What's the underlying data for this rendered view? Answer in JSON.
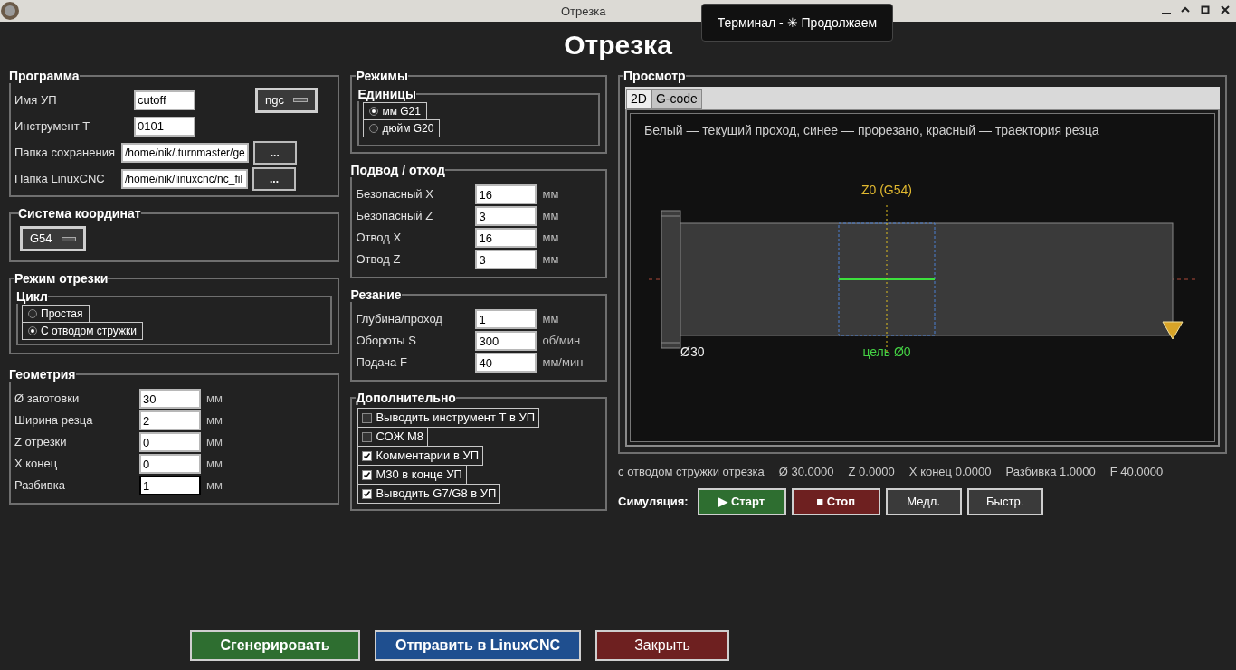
{
  "window": {
    "title": "Отрезка"
  },
  "tooltip": "Терминал - ✳ Продолжаем",
  "heading": "Отрезка",
  "program": {
    "title": "Программа",
    "format": "ngc",
    "fields": [
      {
        "label": "Имя УП",
        "value": "cutoff"
      },
      {
        "label": "Инструмент T",
        "value": "0101"
      },
      {
        "label": "Папка сохранения",
        "value": "/home/nik/.turnmaster/ge",
        "button": "..."
      },
      {
        "label": "Папка LinuxCNC",
        "value": "/home/nik/linuxcnc/nc_fil",
        "button": "..."
      }
    ]
  },
  "coordinate_system": {
    "title": "Система координат",
    "value": "G54"
  },
  "cut_mode": {
    "title": "Режим отрезки",
    "cycle": {
      "title": "Цикл",
      "options": [
        {
          "label": "Простая",
          "selected": false
        },
        {
          "label": "С отводом стружки",
          "selected": true
        }
      ]
    }
  },
  "geometry": {
    "title": "Геометрия",
    "fields": [
      {
        "label": "Ø заготовки",
        "value": "30",
        "unit": "мм",
        "focused": false
      },
      {
        "label": "Ширина резца",
        "value": "2",
        "unit": "мм",
        "focused": false
      },
      {
        "label": "Z отрезки",
        "value": "0",
        "unit": "мм",
        "focused": false
      },
      {
        "label": "X конец",
        "value": "0",
        "unit": "мм",
        "focused": false
      },
      {
        "label": "Разбивка",
        "value": "1",
        "unit": "мм",
        "focused": true
      }
    ]
  },
  "modes": {
    "title": "Режимы",
    "units": {
      "title": "Единицы",
      "options": [
        {
          "label": "мм G21",
          "selected": true
        },
        {
          "label": "дюйм G20",
          "selected": false
        }
      ]
    }
  },
  "approach": {
    "title": "Подвод / отход",
    "fields": [
      {
        "label": "Безопасный X",
        "value": "16",
        "unit": "мм",
        "focused": false
      },
      {
        "label": "Безопасный Z",
        "value": "3",
        "unit": "мм",
        "focused": false
      },
      {
        "label": "Отвод X",
        "value": "16",
        "unit": "мм",
        "focused": false
      },
      {
        "label": "Отвод Z",
        "value": "3",
        "unit": "мм",
        "focused": false
      }
    ]
  },
  "cutting": {
    "title": "Резание",
    "fields": [
      {
        "label": "Глубина/проход",
        "value": "1",
        "unit": "мм",
        "focused": false
      },
      {
        "label": "Обороты S",
        "value": "300",
        "unit": "об/мин",
        "focused": false
      },
      {
        "label": "Подача F",
        "value": "40",
        "unit": "мм/мин",
        "focused": false
      }
    ]
  },
  "extra": {
    "title": "Дополнительно",
    "options": [
      {
        "label": "Выводить инструмент T в УП",
        "checked": false
      },
      {
        "label": "СОЖ M8",
        "checked": false
      },
      {
        "label": "Комментарии в УП",
        "checked": true
      },
      {
        "label": "M30 в конце УП",
        "checked": true
      },
      {
        "label": "Выводить G7/G8 в УП",
        "checked": true
      }
    ]
  },
  "preview": {
    "title": "Просмотр",
    "tabs": [
      {
        "label": "2D",
        "selected": true
      },
      {
        "label": "G-code",
        "selected": false
      }
    ],
    "legend": "Белый — текущий проход, синее — прорезано, красный — траектория резца",
    "z0_label": "Z0 (G54)",
    "diameter_label": "Ø30",
    "target_label": "цель Ø0"
  },
  "status_line": [
    "с отводом стружки отрезка",
    "Ø 30.0000",
    "Z 0.0000",
    "X конец 0.0000",
    "Разбивка 1.0000",
    "F 40.0000"
  ],
  "simulation": {
    "label": "Симуляция:",
    "buttons": [
      {
        "label": "▶ Старт",
        "kind": "start"
      },
      {
        "label": "■ Стоп",
        "kind": "stop"
      },
      {
        "label": "Медл.",
        "kind": "plain"
      },
      {
        "label": "Быстр.",
        "kind": "plain"
      }
    ]
  },
  "actions": [
    {
      "label": "Сгенерировать",
      "kind": "generate"
    },
    {
      "label": "Отправить в LinuxCNC",
      "kind": "send"
    },
    {
      "label": "Закрыть",
      "kind": "close"
    }
  ]
}
